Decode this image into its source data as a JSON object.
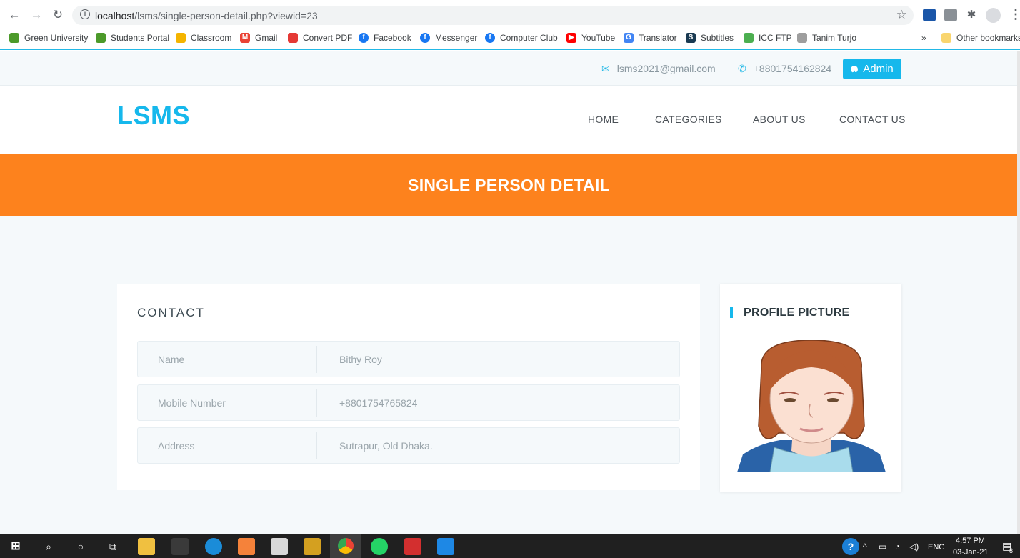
{
  "browser": {
    "url_host": "localhost",
    "url_path": "/lsms/single-person-detail.php?viewid=23",
    "bookmarks": [
      {
        "label": "Green University",
        "color": "#4c9a2a"
      },
      {
        "label": "Students Portal",
        "color": "#4c9a2a"
      },
      {
        "label": "Classroom",
        "color": "#f4b400"
      },
      {
        "label": "Gmail",
        "color": "#ea4335"
      },
      {
        "label": "Convert PDF",
        "color": "#e53935"
      },
      {
        "label": "Facebook",
        "color": "#1877f2"
      },
      {
        "label": "Messenger",
        "color": "#1877f2"
      },
      {
        "label": "Computer Club",
        "color": "#1877f2"
      },
      {
        "label": "YouTube",
        "color": "#ff0000"
      },
      {
        "label": "Translator",
        "color": "#4285f4"
      },
      {
        "label": "Subtitles",
        "color": "#1a3a52"
      },
      {
        "label": "ICC FTP",
        "color": "#4caf50"
      },
      {
        "label": "Tanim Turjo",
        "color": "#9e9e9e"
      }
    ],
    "more_label": "»",
    "other_bookmarks": "Other bookmarks"
  },
  "topbar": {
    "email": "lsms2021@gmail.com",
    "phone": "+8801754162824",
    "admin_label": "Admin"
  },
  "header": {
    "logo": "LSMS",
    "nav": [
      "HOME",
      "CATEGORIES",
      "ABOUT US",
      "CONTACT US"
    ]
  },
  "banner": {
    "title": "SINGLE PERSON DETAIL"
  },
  "contact": {
    "title": "CONTACT",
    "rows": [
      {
        "label": "Name",
        "value": "Bithy Roy"
      },
      {
        "label": "Mobile Number",
        "value": "+8801754765824"
      },
      {
        "label": "Address",
        "value": "Sutrapur, Old Dhaka."
      }
    ]
  },
  "profile": {
    "title": "PROFILE PICTURE"
  },
  "taskbar": {
    "language": "ENG",
    "time": "4:57 PM",
    "date": "03-Jan-21",
    "notif_count": "8"
  },
  "colors": {
    "accent": "#16b8ec",
    "banner": "#fd821d"
  }
}
